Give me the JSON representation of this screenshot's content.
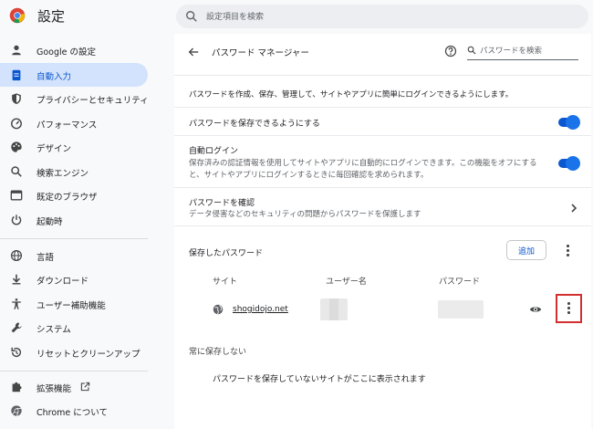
{
  "app": {
    "title": "設定"
  },
  "search": {
    "placeholder": "設定項目を検索"
  },
  "sidebar": {
    "items": [
      {
        "label": "Google の設定",
        "icon": "person-icon"
      },
      {
        "label": "自動入力",
        "icon": "clipboard-icon",
        "active": true
      },
      {
        "label": "プライバシーとセキュリティ",
        "icon": "shield-icon"
      },
      {
        "label": "パフォーマンス",
        "icon": "speedometer-icon"
      },
      {
        "label": "デザイン",
        "icon": "palette-icon"
      },
      {
        "label": "検索エンジン",
        "icon": "search-icon"
      },
      {
        "label": "既定のブラウザ",
        "icon": "browser-icon"
      },
      {
        "label": "起動時",
        "icon": "power-icon"
      },
      {
        "label": "言語",
        "icon": "globe-icon"
      },
      {
        "label": "ダウンロード",
        "icon": "download-icon"
      },
      {
        "label": "ユーザー補助機能",
        "icon": "accessibility-icon"
      },
      {
        "label": "システム",
        "icon": "wrench-icon"
      },
      {
        "label": "リセットとクリーンアップ",
        "icon": "reset-icon"
      },
      {
        "label": "拡張機能",
        "icon": "puzzle-icon"
      },
      {
        "label": "Chrome について",
        "icon": "chrome-icon"
      }
    ]
  },
  "main": {
    "title": "パスワード マネージャー",
    "search_placeholder": "パスワードを検索",
    "description": "パスワードを作成、保存、管理して、サイトやアプリに簡単にログインできるようにします。",
    "offer_to_save": {
      "label": "パスワードを保存できるようにする",
      "enabled": true
    },
    "auto_signin": {
      "label": "自動ログイン",
      "desc_line1": "保存済みの認証情報を使用してサイトやアプリに自動的にログインできます。この機能をオフにする",
      "desc_line2": "と、サイトやアプリにログインするときに毎回確認を求められます。",
      "enabled": true
    },
    "check_passwords": {
      "label": "パスワードを確認",
      "desc": "データ侵害などのセキュリティの問題からパスワードを保護します"
    },
    "saved": {
      "heading": "保存したパスワード",
      "add_label": "追加",
      "columns": {
        "site": "サイト",
        "username": "ユーザー名",
        "password": "パスワード"
      },
      "rows": [
        {
          "site": "shogidojo.net"
        }
      ]
    },
    "never_saved": {
      "heading": "常に保存しない",
      "empty": "パスワードを保存していないサイトがここに表示されます"
    }
  },
  "colors": {
    "accent": "#0b57d0",
    "active_nav_bg": "#d3e3fd",
    "highlight": "#d32f2f"
  }
}
